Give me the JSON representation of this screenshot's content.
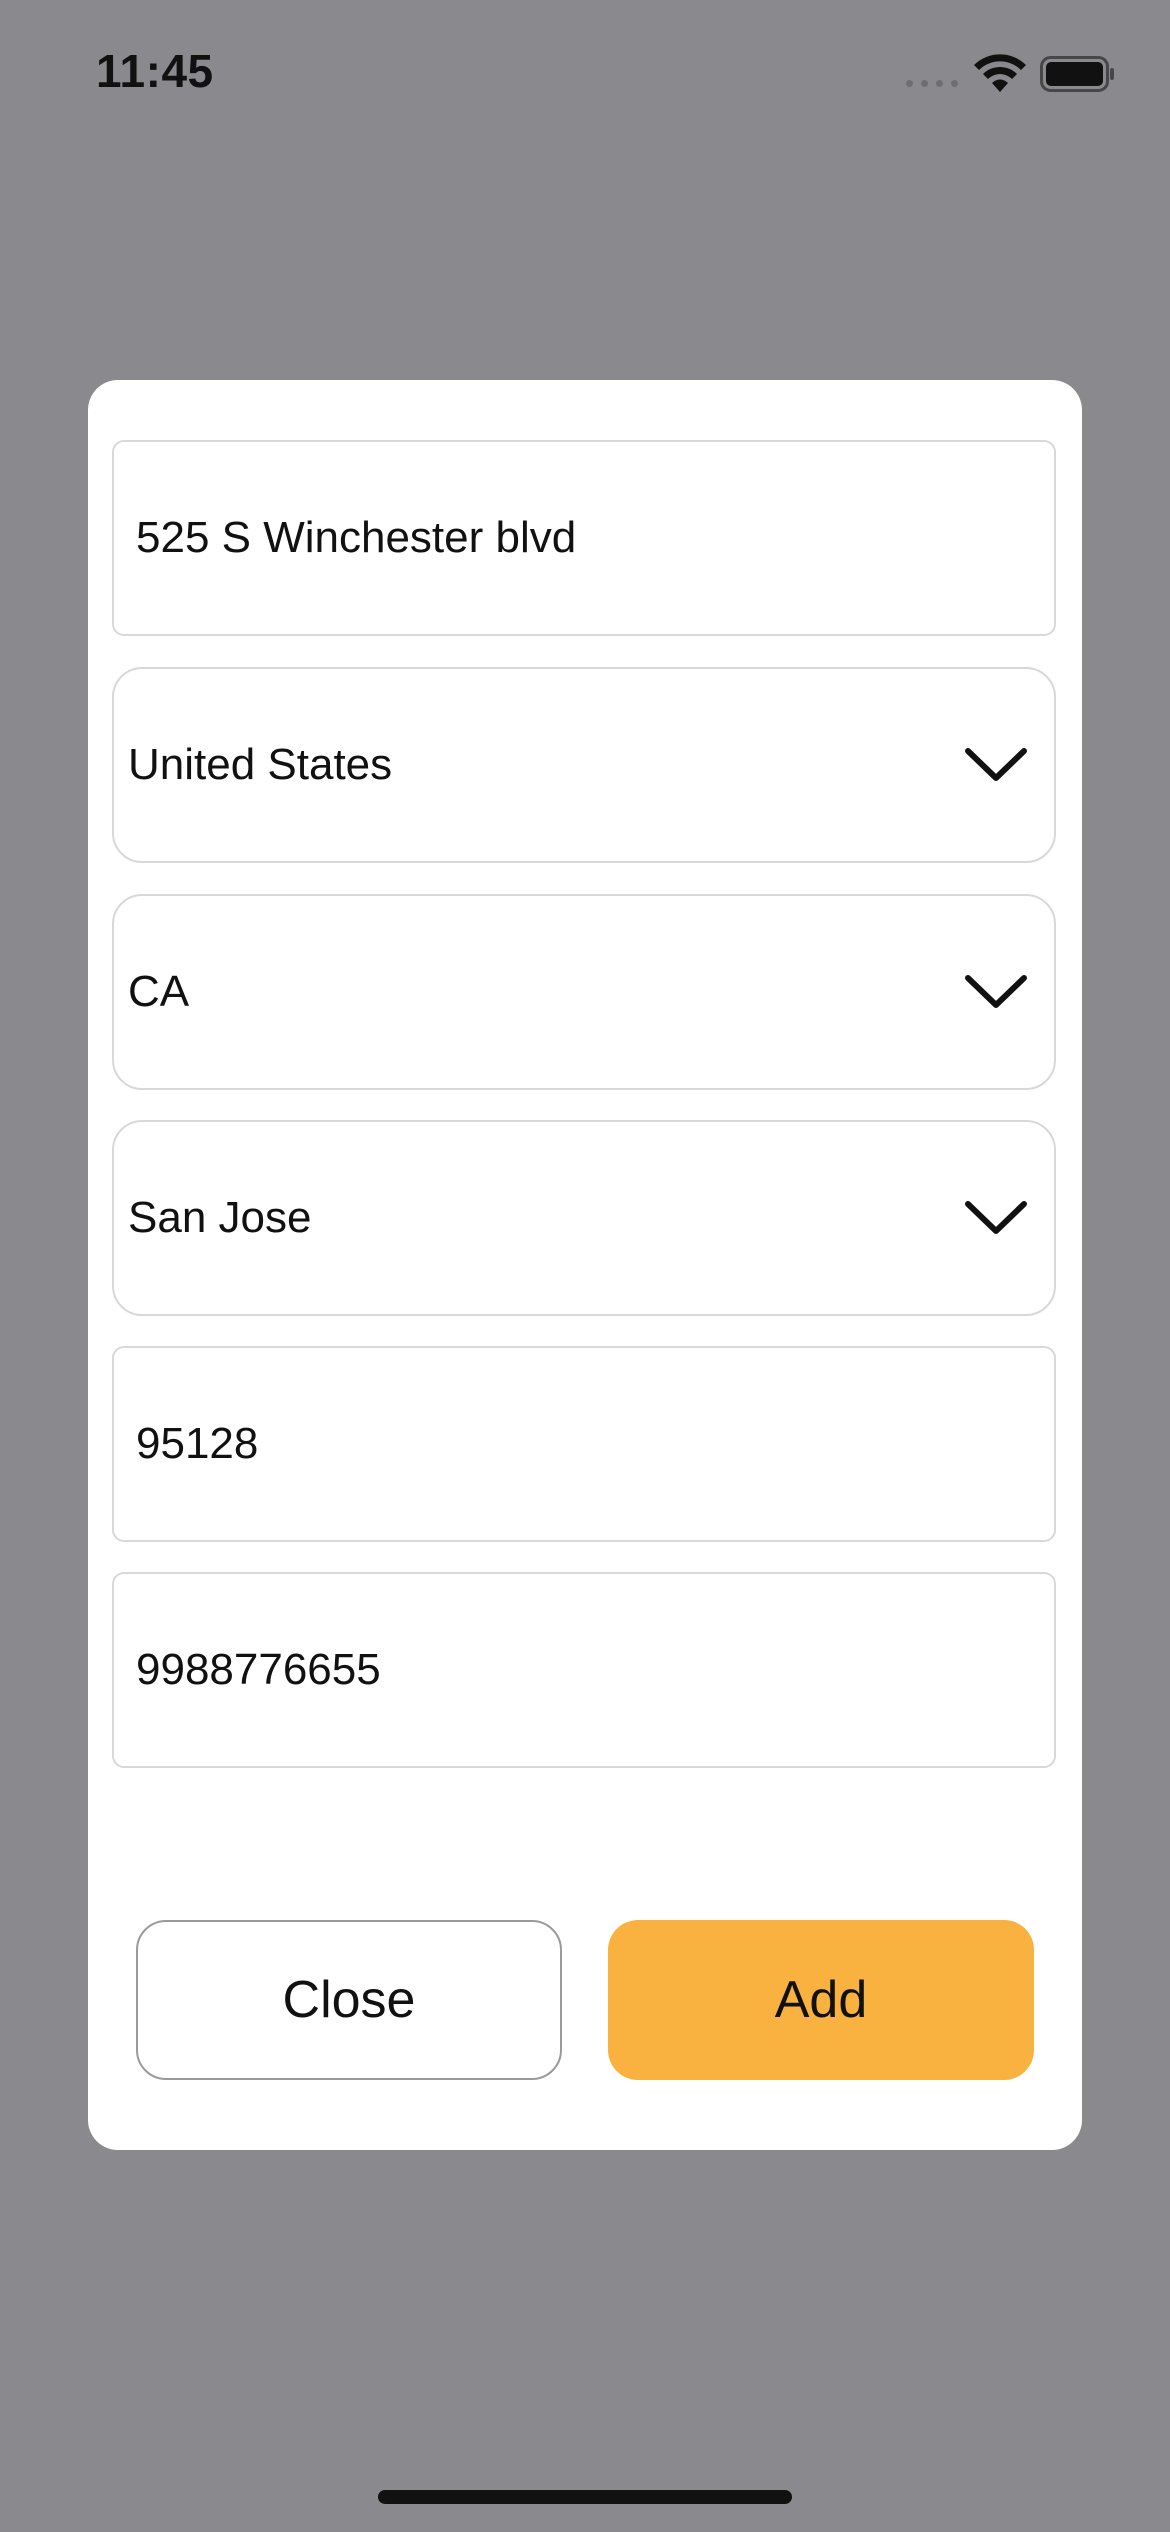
{
  "status_bar": {
    "time": "11:45",
    "wifi_icon": "wifi-icon",
    "battery_icon": "battery-icon"
  },
  "form": {
    "address": {
      "value": "525 S Winchester blvd"
    },
    "country": {
      "value": "United States",
      "icon": "chevron-down-icon"
    },
    "state": {
      "value": "CA",
      "icon": "chevron-down-icon"
    },
    "city": {
      "value": "San Jose",
      "icon": "chevron-down-icon"
    },
    "zip": {
      "value": "95128"
    },
    "phone": {
      "value": "9988776655"
    }
  },
  "actions": {
    "close_label": "Close",
    "add_label": "Add"
  },
  "colors": {
    "overlay": "#8a898e",
    "modal": "#ffffff",
    "add_button": "#f9b13f",
    "field_border": "#d8d8d8"
  }
}
